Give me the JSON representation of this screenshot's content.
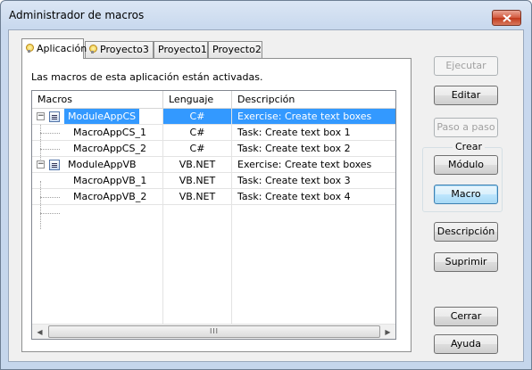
{
  "window": {
    "title": "Administrador de macros"
  },
  "tabs": [
    {
      "label": "Aplicación",
      "active": true,
      "icon": "bulb-icon"
    },
    {
      "label": "Proyecto3",
      "active": false,
      "icon": "bulb-icon"
    },
    {
      "label": "Proyecto1",
      "active": false
    },
    {
      "label": "Proyecto2",
      "active": false
    }
  ],
  "panel": {
    "status_text": "Las macros de esta aplicación están activadas."
  },
  "table": {
    "columns": [
      "Macros",
      "Lenguaje",
      "Descripción"
    ],
    "rows": [
      {
        "name": "ModuleAppCS",
        "language": "C#",
        "description": "Exercise: Create text boxes",
        "type": "module",
        "selected": true
      },
      {
        "name": "MacroAppCS_1",
        "language": "C#",
        "description": "Task: Create text box 1",
        "type": "macro"
      },
      {
        "name": "MacroAppCS_2",
        "language": "C#",
        "description": "Task: Create text box 2",
        "type": "macro"
      },
      {
        "name": "ModuleAppVB",
        "language": "VB.NET",
        "description": "Exercise: Create text boxes",
        "type": "module"
      },
      {
        "name": "MacroAppVB_1",
        "language": "VB.NET",
        "description": "Task: Create text box 3",
        "type": "macro"
      },
      {
        "name": "MacroAppVB_2",
        "language": "VB.NET",
        "description": "Task: Create text box 4",
        "type": "macro"
      }
    ],
    "scroll_thumb_grip": "III"
  },
  "buttons": {
    "ejecutar": "Ejecutar",
    "editar": "Editar",
    "paso_a_paso": "Paso a paso",
    "crear_group": "Crear",
    "modulo": "Módulo",
    "macro": "Macro",
    "descripcion": "Descripción",
    "suprimir": "Suprimir",
    "cerrar": "Cerrar",
    "ayuda": "Ayuda"
  },
  "colors": {
    "selection": "#3399ff",
    "close_button": "#c94a2d"
  }
}
